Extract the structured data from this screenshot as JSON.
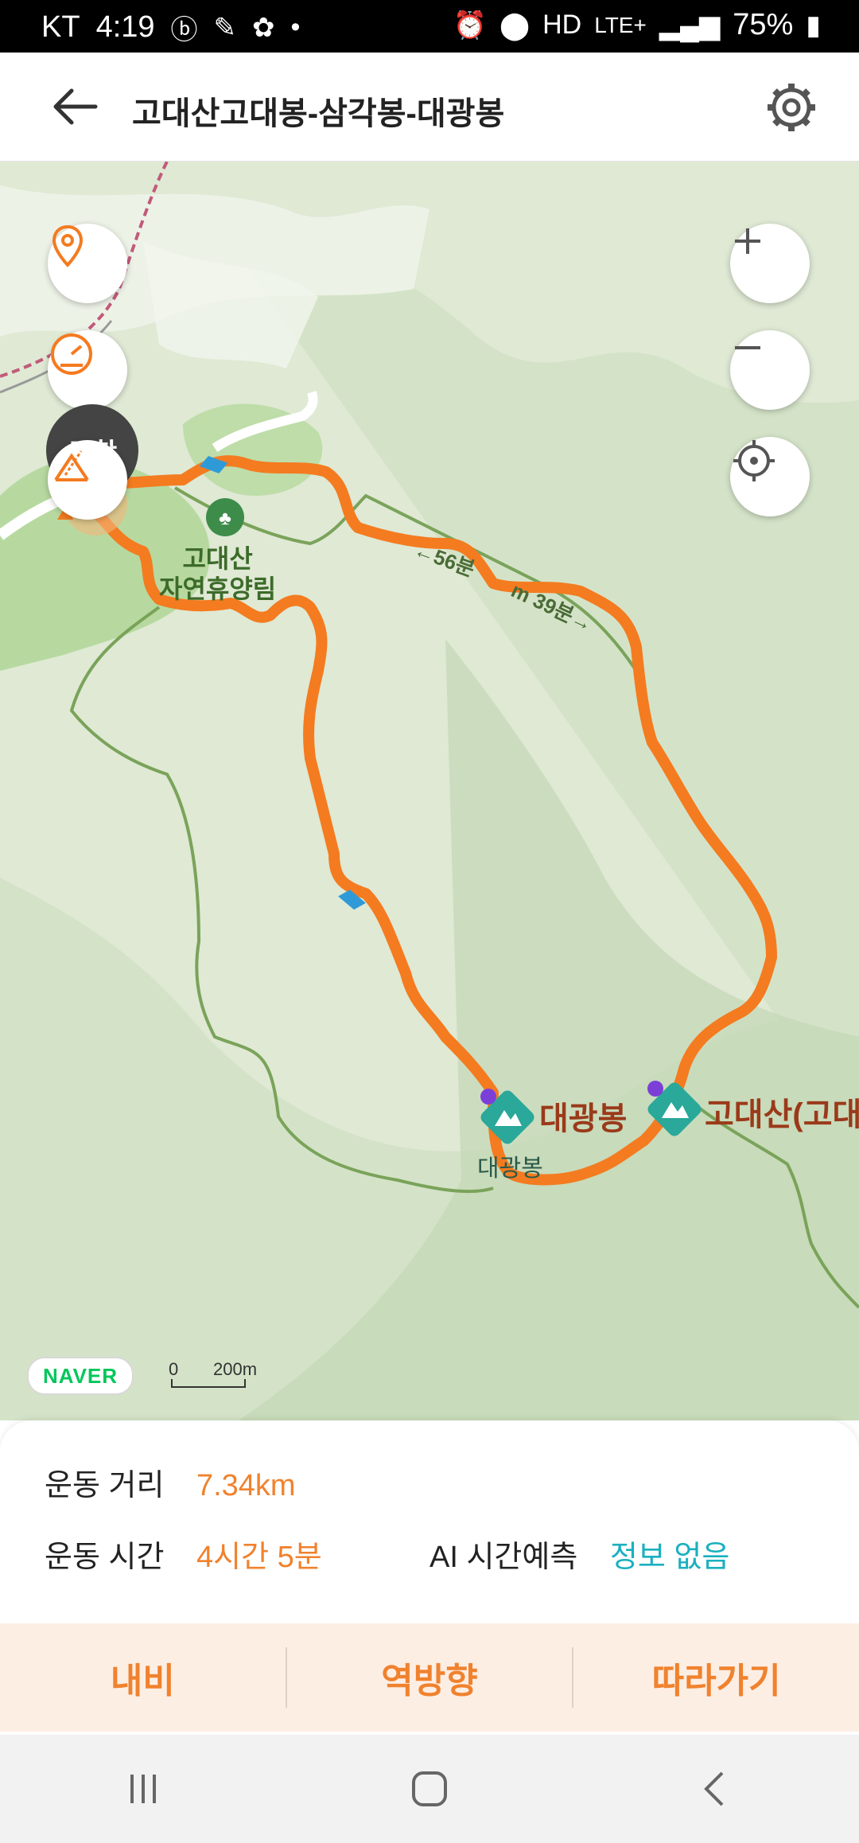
{
  "status": {
    "carrier": "KT",
    "time": "4:19",
    "network": "LTE+",
    "battery": "75%"
  },
  "header": {
    "title": "고대산고대봉-삼각봉-대광봉"
  },
  "map": {
    "labels": {
      "forest": "고대산\n자연휴양림",
      "peak_main": "대광봉",
      "peak_sub": "대광봉",
      "peak_right": "고대산(고대",
      "trail_time_a": "←56분",
      "trail_time_b": "m 39분→"
    },
    "scale": {
      "zero": "0",
      "distance": "200m"
    },
    "logo": "NAVER",
    "start_badge": "도착"
  },
  "info": {
    "distance_label": "운동 거리",
    "distance_value": "7.34km",
    "time_label": "운동 시간",
    "time_value": "4시간 5분",
    "ai_label": "AI 시간예측",
    "ai_value": "정보 없음"
  },
  "actions": {
    "nav": "내비",
    "reverse": "역방향",
    "follow": "따라가기"
  },
  "colors": {
    "route": "#f47b20",
    "accent": "#f0822e",
    "teal": "#1ab0bf",
    "map_bg": "#dfe9d4"
  }
}
